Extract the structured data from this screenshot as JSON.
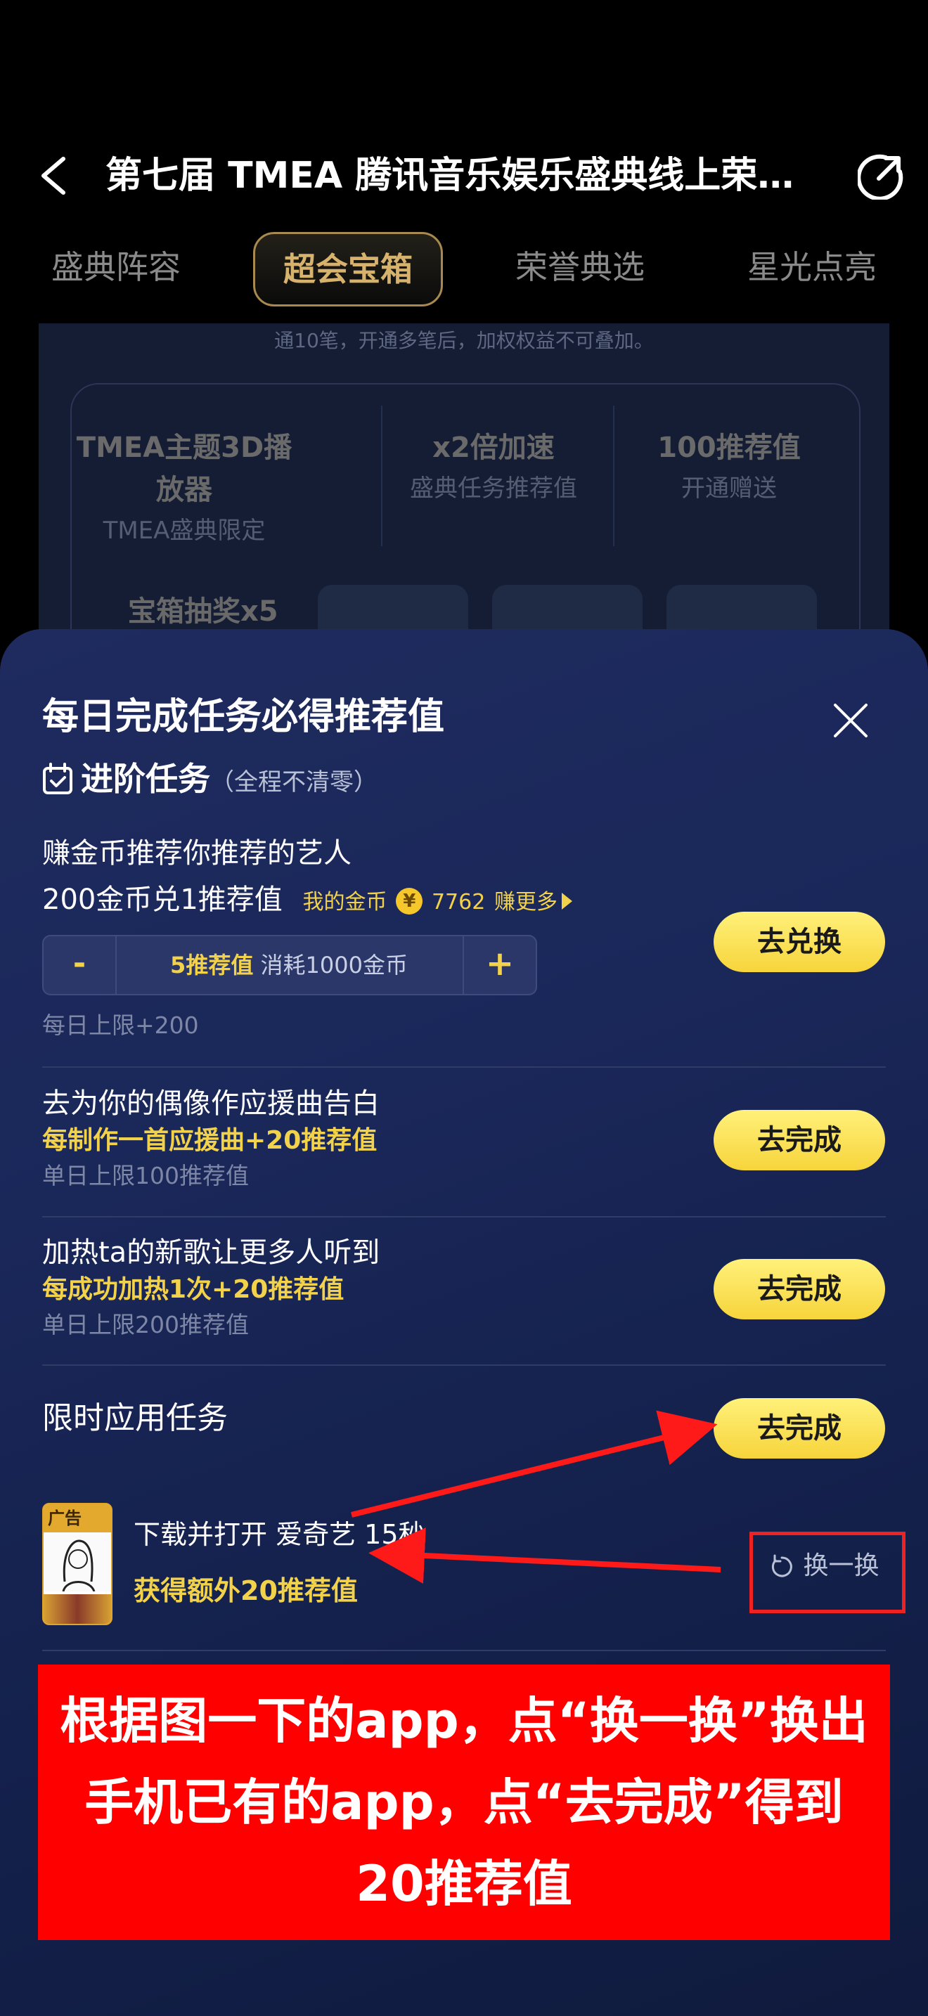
{
  "header": {
    "title": "第七届 TMEA 腾讯音乐娱乐盛典线上荣誉...",
    "tabs": [
      {
        "label": "盛典阵容",
        "active": false
      },
      {
        "label": "超会宝箱",
        "active": true
      },
      {
        "label": "荣誉典选",
        "active": false
      },
      {
        "label": "星光点亮",
        "active": false
      }
    ]
  },
  "background_page": {
    "note": "通10笔，开通多笔后，加权权益不可叠加。",
    "benefits": [
      {
        "title": "TMEA主题3D播放器",
        "subtitle": "TMEA盛典限定"
      },
      {
        "title": "x2倍加速",
        "subtitle": "盛典任务推荐值"
      },
      {
        "title": "100推荐值",
        "subtitle": "开通赠送"
      }
    ],
    "lottery_label": "宝箱抽奖x5"
  },
  "sheet": {
    "title": "每日完成任务必得推荐值",
    "section": {
      "title": "进阶任务",
      "note": "（全程不清零）"
    },
    "exchange_task": {
      "title": "赚金币推荐你推荐的艺人",
      "rate": "200金币兑1推荐值",
      "my_coins_label": "我的金币",
      "coin_symbol": "¥",
      "coins": "7762",
      "earn_more": "赚更多",
      "stepper": {
        "minus": "-",
        "plus": "+",
        "value": "5推荐值",
        "cost": "消耗1000金币"
      },
      "limit": "每日上限+200",
      "button": "去兑换"
    },
    "tasks": [
      {
        "title": "去为你的偶像作应援曲告白",
        "highlight": "每制作一首应援曲+20推荐值",
        "limit": "单日上限100推荐值",
        "button": "去完成"
      },
      {
        "title": "加热ta的新歌让更多人听到",
        "highlight": "每成功加热1次+20推荐值",
        "limit": "单日上限200推荐值",
        "button": "去完成"
      }
    ],
    "limited_task": {
      "title": "限时应用任务",
      "button": "去完成",
      "app_icon_text": "广告",
      "app_task": "下载并打开 爱奇艺 15秒",
      "reward": "获得额外20推荐值",
      "refresh": "换一换"
    }
  },
  "annotation": {
    "text": "根据图一下的app，点“换一换”换出手机已有的app，点“去完成”得到20推荐值",
    "color": "#ff0000"
  },
  "colors": {
    "accent_gold": "#f3d24b",
    "button_yellow": "#f9dd4a",
    "tab_active": "#d7b26d",
    "sheet_bg": "#1c2a5c"
  }
}
